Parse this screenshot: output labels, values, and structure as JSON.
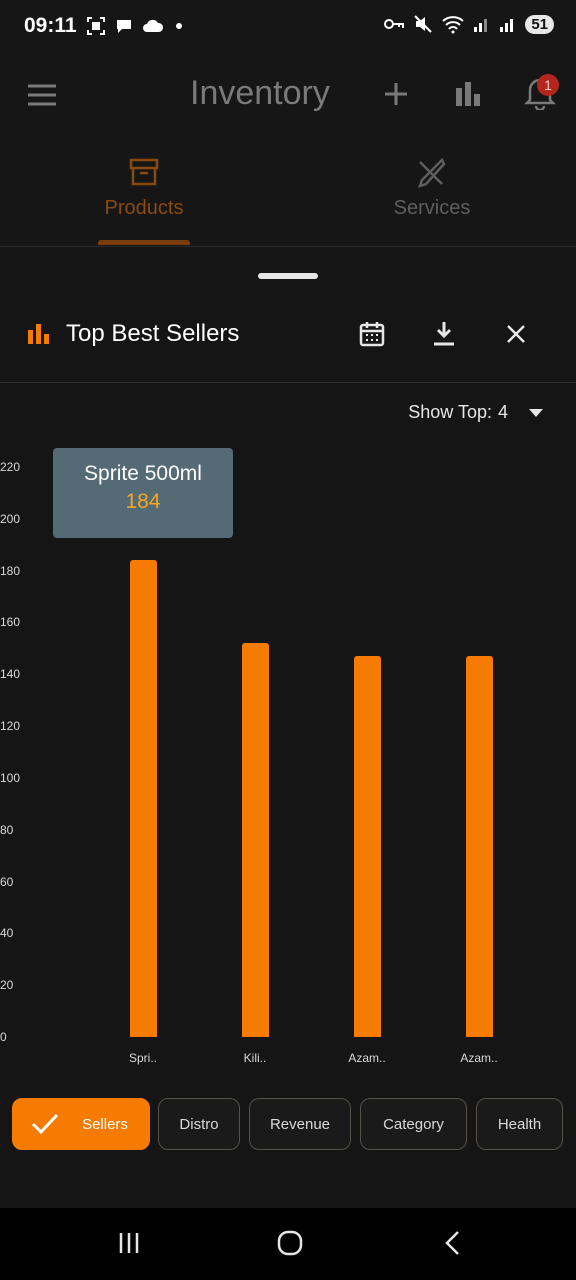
{
  "status_bar": {
    "time": "09:11",
    "battery": "51",
    "icons": [
      "screenshot-icon",
      "chat-icon",
      "cloud-icon",
      "dot-icon",
      "key-icon",
      "mute-icon",
      "wifi-icon",
      "signal-icon",
      "signal-icon-2"
    ]
  },
  "app_bar": {
    "title": "Inventory",
    "notification_count": "1"
  },
  "tabs": [
    {
      "label": "Products",
      "icon": "archive-icon",
      "active": true
    },
    {
      "label": "Services",
      "icon": "tools-icon",
      "active": false
    }
  ],
  "sheet": {
    "title": "Top Best Sellers",
    "show_top_label": "Show Top:",
    "show_top_value": "4"
  },
  "colors": {
    "accent": "#f57c00",
    "tooltip_bg": "#546a75",
    "tooltip_value": "#f5a623"
  },
  "chart_data": {
    "type": "bar",
    "categories": [
      "Spri..",
      "Kili..",
      "Azam..",
      "Azam.."
    ],
    "values": [
      184,
      152,
      147,
      147
    ],
    "ylim": [
      0,
      220
    ],
    "yticks": [
      "0",
      "20",
      "40",
      "60",
      "80",
      "100",
      "120",
      "140",
      "160",
      "180",
      "200",
      "220"
    ],
    "tooltip": {
      "label": "Sprite 500ml",
      "value": "184"
    },
    "grid": false
  },
  "filters": [
    {
      "label": "Sellers",
      "selected": true
    },
    {
      "label": "Distro",
      "selected": false
    },
    {
      "label": "Revenue",
      "selected": false
    },
    {
      "label": "Category",
      "selected": false
    },
    {
      "label": "Health",
      "selected": false
    }
  ]
}
